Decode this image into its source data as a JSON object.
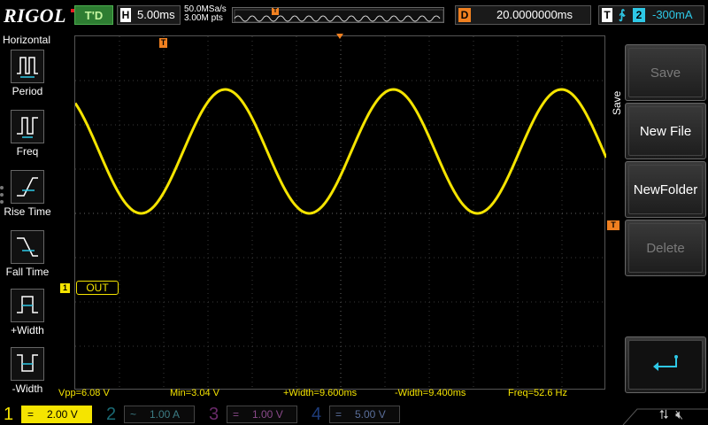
{
  "header": {
    "logo": "RIGOL",
    "run_status": "T'D",
    "horizontal_label": "H",
    "timebase": "5.00ms",
    "sample_rate": "50.0MSa/s",
    "memory_depth": "3.00M pts",
    "delay_label": "D",
    "delay_value": "20.0000000ms",
    "trigger_label": "T",
    "trigger_edge": "rising-edge-icon",
    "trigger_source": "2",
    "trigger_level": "-300mA"
  },
  "left_panel": {
    "title": "Horizontal",
    "items": [
      {
        "label": "Period",
        "icon": "period-icon"
      },
      {
        "label": "Freq",
        "icon": "freq-icon"
      },
      {
        "label": "Rise Time",
        "icon": "rise-time-icon"
      },
      {
        "label": "Fall Time",
        "icon": "fall-time-icon"
      },
      {
        "label": "+Width",
        "icon": "positive-width-icon"
      },
      {
        "label": "-Width",
        "icon": "negative-width-icon"
      }
    ]
  },
  "display": {
    "trigger_pos_marker": "T",
    "trigger_level_marker": "T",
    "channel_marker": "1",
    "channel_label": "OUT",
    "trace_color": "#f5e400"
  },
  "measurements": {
    "vpp": "Vpp=6.08 V",
    "min": "Min=3.04 V",
    "pwidth": "+Width=9.600ms",
    "nwidth": "-Width=9.400ms",
    "freq": "Freq=52.6 Hz"
  },
  "right_panel": {
    "title": "Save",
    "buttons": [
      {
        "label": "Save",
        "enabled": false
      },
      {
        "label": "New File",
        "enabled": true
      },
      {
        "label": "NewFolder",
        "enabled": true
      },
      {
        "label": "Delete",
        "enabled": false
      }
    ],
    "back_icon": "return-arrow-icon"
  },
  "channels": [
    {
      "num": "1",
      "coupling": "=",
      "scale": "2.00 V",
      "color": "#f5e400",
      "active": true
    },
    {
      "num": "2",
      "coupling": "~",
      "scale": "1.00 A",
      "color": "#1a6a74",
      "active": false
    },
    {
      "num": "3",
      "coupling": "=",
      "scale": "1.00 V",
      "color": "#6a2a6a",
      "active": false
    },
    {
      "num": "4",
      "coupling": "=",
      "scale": "5.00 V",
      "color": "#1e3c7a",
      "active": false
    }
  ],
  "system_icons": [
    "usb-icon",
    "mute-speaker-icon"
  ]
}
